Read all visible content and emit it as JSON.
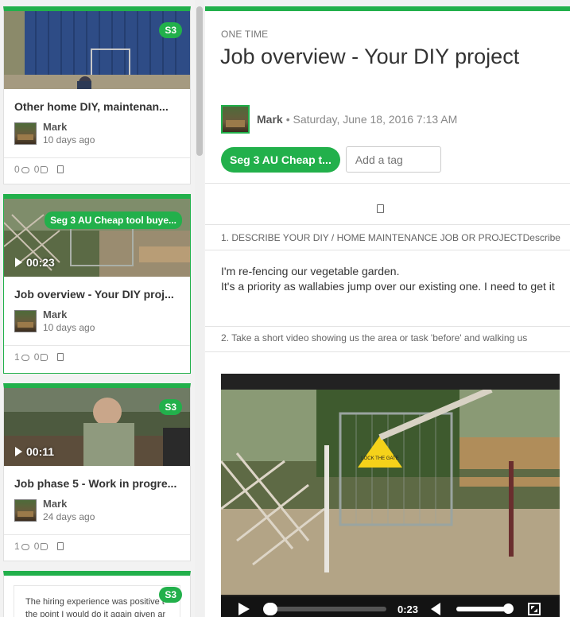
{
  "feed": {
    "cards": [
      {
        "badge": "S3",
        "title": "Other home DIY, maintenan...",
        "author": "Mark",
        "date": "10 days ago",
        "comments": "0",
        "likes": "0"
      },
      {
        "tag": "Seg 3 AU Cheap tool buye...",
        "duration": "00:23",
        "title": "Job overview - Your DIY proj...",
        "author": "Mark",
        "date": "10 days ago",
        "comments": "1",
        "likes": "0"
      },
      {
        "badge": "S3",
        "duration": "00:11",
        "title": "Job phase 5 - Work in progre...",
        "author": "Mark",
        "date": "24 days ago",
        "comments": "1",
        "likes": "0"
      },
      {
        "badge": "S3",
        "text_line1": "The hiring experience was positive t",
        "text_line2": "the point I would do it again given an"
      }
    ]
  },
  "detail": {
    "frequency": "ONE TIME",
    "title": "Job overview - Your DIY project",
    "author": "Mark",
    "date": "• Saturday, June 18, 2016 7:13 AM",
    "tag": "Seg 3 AU Cheap t...",
    "tag_placeholder": "Add a tag",
    "q1": "1.  DESCRIBE YOUR DIY / HOME MAINTENANCE JOB OR PROJECTDescribe",
    "answer_line1": "I'm re-fencing our vegetable garden.",
    "answer_line2": "It's a priority as wallabies jump over our existing one. I need to get it",
    "q2": "2.  Take a short video showing us the area or task 'before' and walking us",
    "video": {
      "time": "0:23",
      "sign_text": "LOCK THE GATE"
    }
  },
  "colors": {
    "accent": "#22b04b"
  }
}
